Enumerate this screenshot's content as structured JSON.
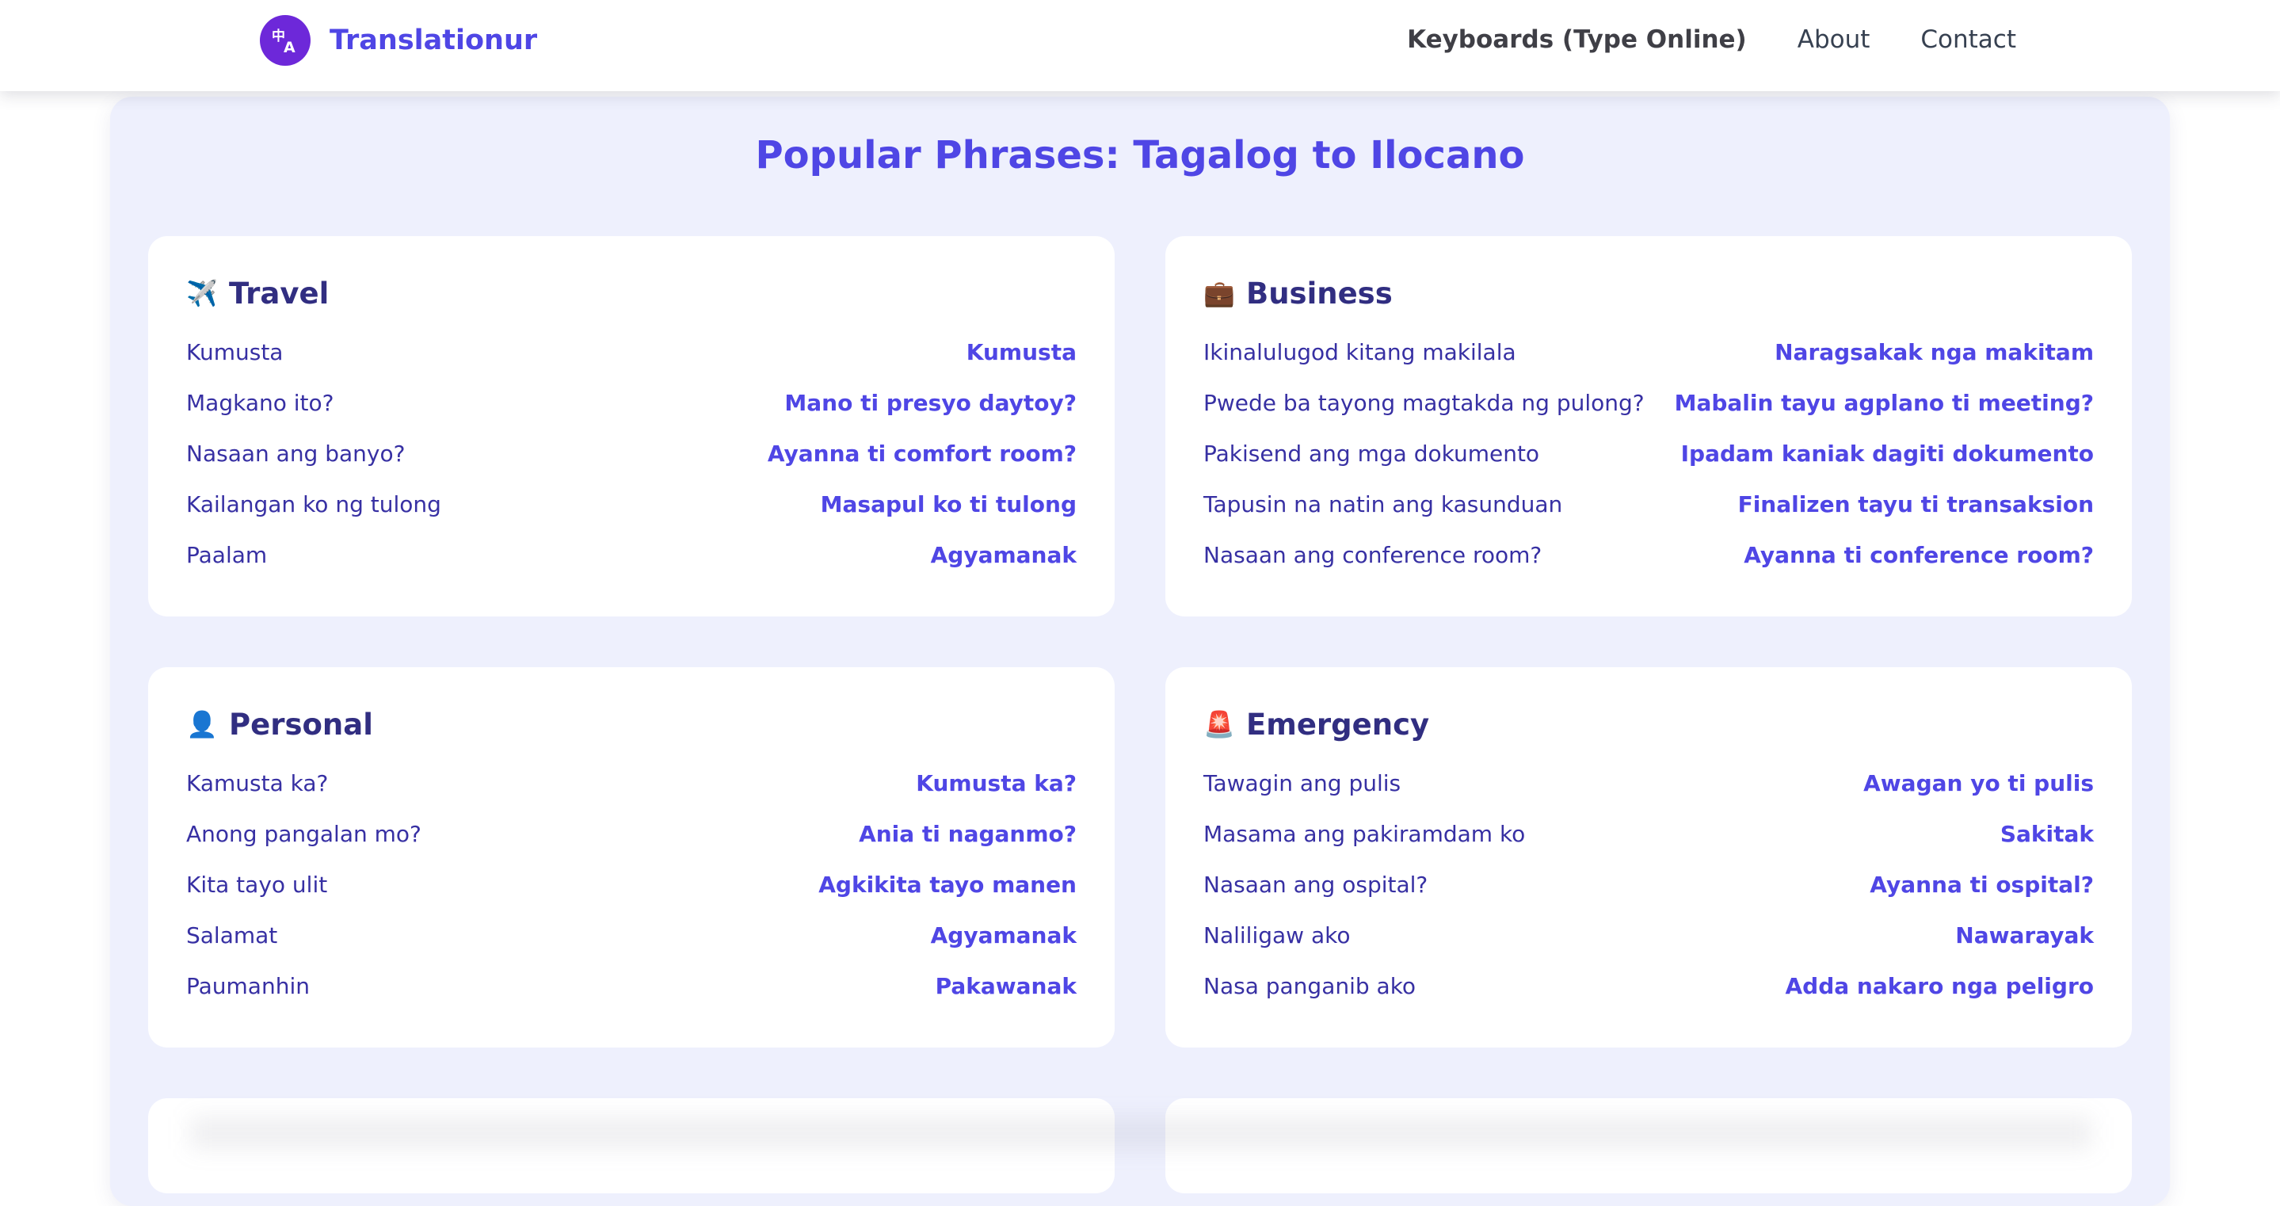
{
  "header": {
    "brand": "Translationur",
    "nav": [
      {
        "label": "Keyboards (Type Online)"
      },
      {
        "label": "About"
      },
      {
        "label": "Contact"
      }
    ]
  },
  "section": {
    "title": "Popular Phrases: Tagalog to Ilocano"
  },
  "cards": [
    {
      "emoji": "✈️",
      "title": "Travel",
      "rows": [
        {
          "src": "Kumusta",
          "dst": "Kumusta"
        },
        {
          "src": "Magkano ito?",
          "dst": "Mano ti presyo daytoy?"
        },
        {
          "src": "Nasaan ang banyo?",
          "dst": "Ayanna ti comfort room?"
        },
        {
          "src": "Kailangan ko ng tulong",
          "dst": "Masapul ko ti tulong"
        },
        {
          "src": "Paalam",
          "dst": "Agyamanak"
        }
      ]
    },
    {
      "emoji": "💼",
      "title": "Business",
      "rows": [
        {
          "src": "Ikinalulugod kitang makilala",
          "dst": "Naragsakak nga makitam"
        },
        {
          "src": "Pwede ba tayong magtakda ng pulong?",
          "dst": "Mabalin tayu agplano ti meeting?"
        },
        {
          "src": "Pakisend ang mga dokumento",
          "dst": "Ipadam kaniak dagiti dokumento"
        },
        {
          "src": "Tapusin na natin ang kasunduan",
          "dst": "Finalizen tayu ti transaksion"
        },
        {
          "src": "Nasaan ang conference room?",
          "dst": "Ayanna ti conference room?"
        }
      ]
    },
    {
      "emoji": "👤",
      "title": "Personal",
      "rows": [
        {
          "src": "Kamusta ka?",
          "dst": "Kumusta ka?"
        },
        {
          "src": "Anong pangalan mo?",
          "dst": "Ania ti naganmo?"
        },
        {
          "src": "Kita tayo ulit",
          "dst": "Agkikita tayo manen"
        },
        {
          "src": "Salamat",
          "dst": "Agyamanak"
        },
        {
          "src": "Paumanhin",
          "dst": "Pakawanak"
        }
      ]
    },
    {
      "emoji": "🚨",
      "title": "Emergency",
      "rows": [
        {
          "src": "Tawagin ang pulis",
          "dst": "Awagan yo ti pulis"
        },
        {
          "src": "Masama ang pakiramdam ko",
          "dst": "Sakitak"
        },
        {
          "src": "Nasaan ang ospital?",
          "dst": "Ayanna ti ospital?"
        },
        {
          "src": "Naliligaw ako",
          "dst": "Nawarayak"
        },
        {
          "src": "Nasa panganib ako",
          "dst": "Adda nakaro nga peligro"
        }
      ]
    }
  ]
}
